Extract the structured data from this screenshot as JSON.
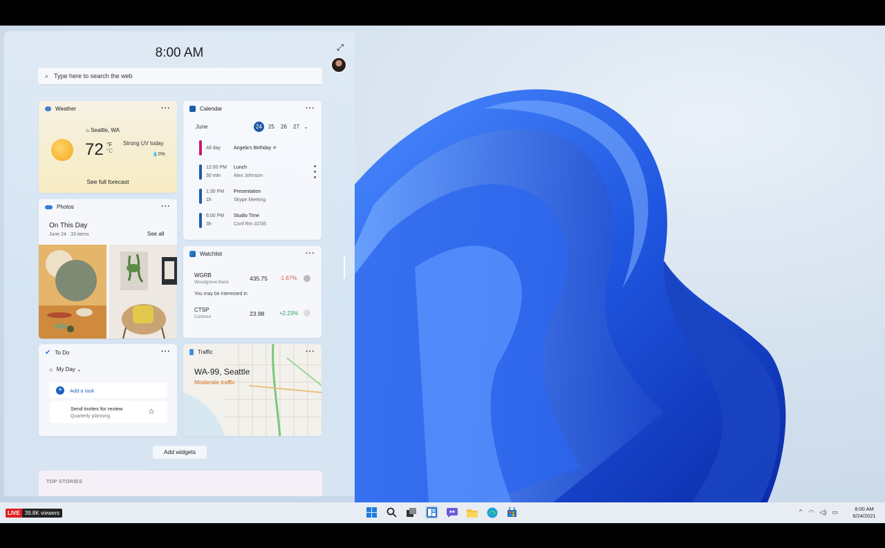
{
  "widgets": {
    "time": "8:00 AM",
    "search_placeholder": "Type here to search the web",
    "add_widgets": "Add widgets",
    "top_stories": "TOP STORIES"
  },
  "weather": {
    "title": "Weather",
    "location": "Seattle, WA",
    "temp": "72",
    "unit_f": "°F",
    "unit_c": "°C",
    "condition": "Strong UV today",
    "precip": "0%",
    "link": "See full forecast"
  },
  "calendar": {
    "title": "Calendar",
    "month": "June",
    "days": [
      "24",
      "25",
      "26",
      "27"
    ],
    "events": [
      {
        "time": "All day",
        "duration": "",
        "title": "Angela's Birthday",
        "sub": "",
        "color": "#c8196a"
      },
      {
        "time": "12:00 PM",
        "duration": "30 min",
        "title": "Lunch",
        "sub": "Alex Johnson",
        "color": "#1f5aa6"
      },
      {
        "time": "1:30 PM",
        "duration": "1h",
        "title": "Presentation",
        "sub": "Skype Meeting",
        "color": "#1f5aa6"
      },
      {
        "time": "6:00 PM",
        "duration": "3h",
        "title": "Studio Time",
        "sub": "Conf Rm 32/35",
        "color": "#1f5aa6"
      }
    ]
  },
  "photos": {
    "title": "Photos",
    "heading": "On This Day",
    "sub": "June 24 · 33 items",
    "see_all": "See all"
  },
  "watchlist": {
    "title": "Watchlist",
    "hint": "You may be interested in",
    "stocks": [
      {
        "symbol": "WGRB",
        "name": "Woodgrove Bank",
        "price": "435.75",
        "change": "-1.67%",
        "color": "#d9534f"
      },
      {
        "symbol": "CTSP",
        "name": "Contoso",
        "price": "23.98",
        "change": "+2.23%",
        "color": "#2a9d5a"
      }
    ]
  },
  "todo": {
    "title": "To Do",
    "list": "My Day",
    "add": "Add a task",
    "task": "Send invites for review",
    "task_sub": "Quarterly planning"
  },
  "traffic": {
    "title": "Traffic",
    "road": "WA-99, Seattle",
    "status": "Moderate traffic"
  },
  "taskbar": {
    "time": "8:00 AM",
    "date": "6/24/2021"
  },
  "stream": {
    "live": "LIVE",
    "viewers": "39.8K viewers"
  }
}
